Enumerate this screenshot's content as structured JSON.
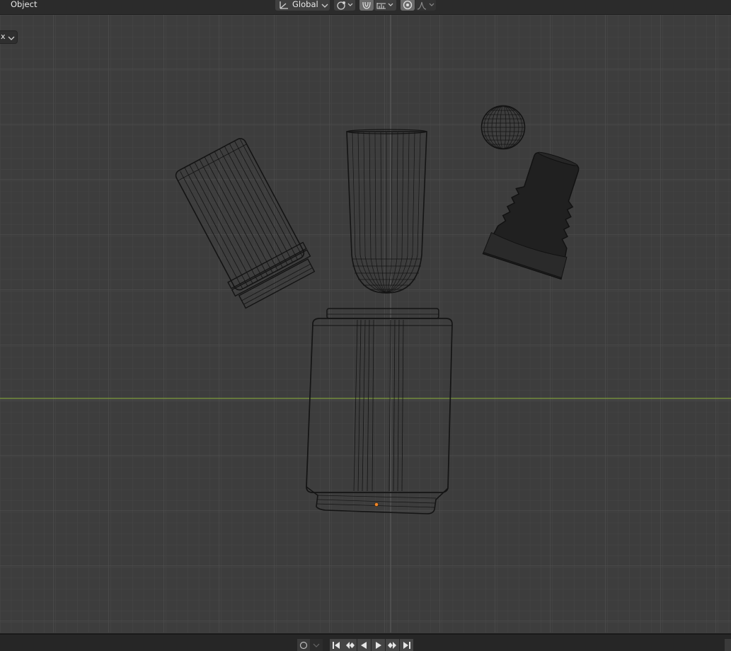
{
  "header": {
    "mode_label": "Object",
    "transform_orientation": "Global",
    "icons": [
      "orientation-axes-icon",
      "chevron-down-icon",
      "pivot-point-icon",
      "snap-magnet-icon",
      "snap-increment-icon",
      "proportional-edit-icon",
      "falloff-curve-icon"
    ]
  },
  "viewport": {
    "left_dropdown_label": "x",
    "background": "#3d3d3d",
    "x_axis_color": "#7e9c3c",
    "objects": [
      "tilted-ribbed-cylinder",
      "capsule-wireframe",
      "sphere-wireframe",
      "threaded-cap-solid",
      "main-jar-body",
      "origin-point"
    ]
  },
  "timeline": {
    "controls": [
      "keyframe-record-icon",
      "jump-to-start-icon",
      "previous-keyframe-icon",
      "play-reverse-icon",
      "play-icon",
      "next-keyframe-icon",
      "jump-to-end-icon"
    ]
  }
}
